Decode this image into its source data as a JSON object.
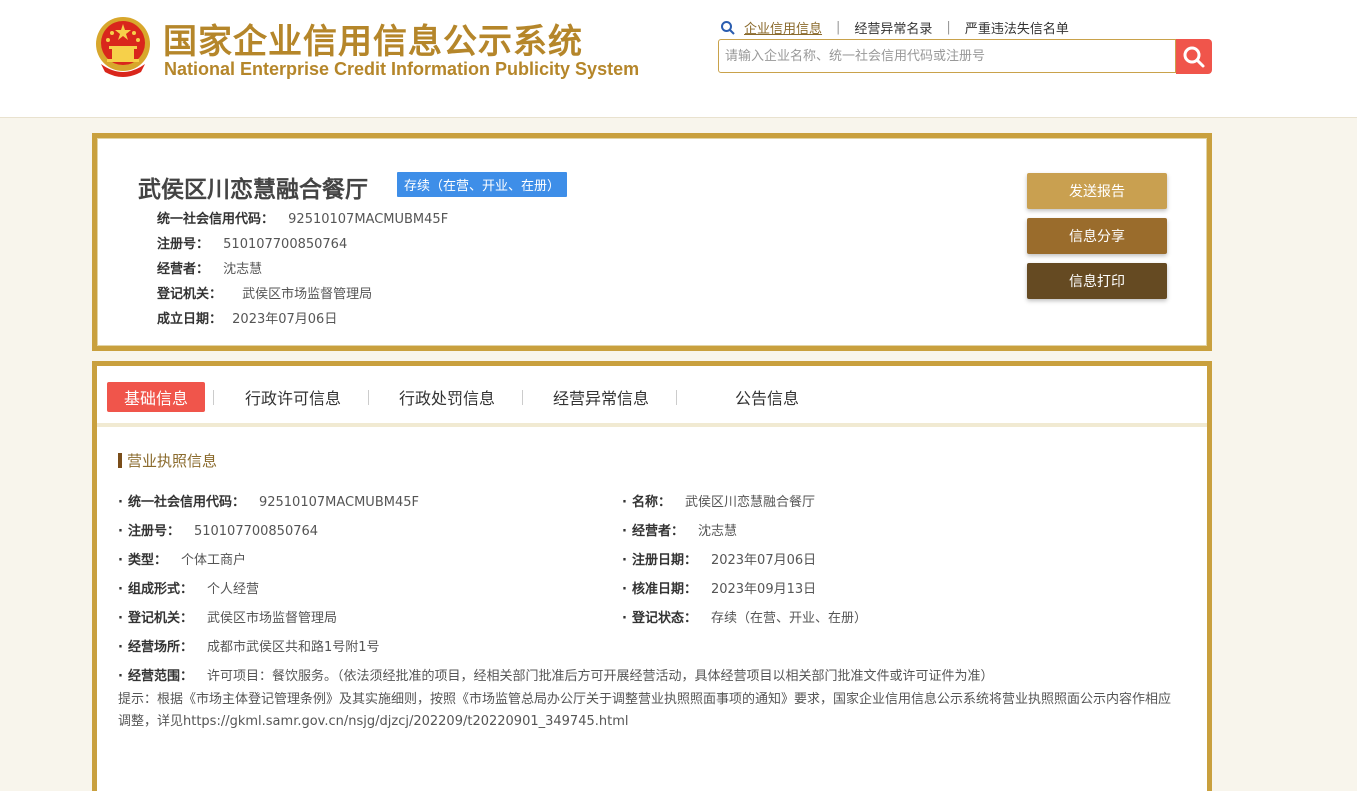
{
  "header": {
    "title_cn": "国家企业信用信息公示系统",
    "title_en": "National Enterprise Credit Information Publicity System",
    "links": [
      "企业信用信息",
      "经营异常名录",
      "严重违法失信名单"
    ],
    "search_placeholder": "请输入企业名称、统一社会信用代码或注册号"
  },
  "summary": {
    "company_name": "武侯区川恋慧融合餐厅",
    "status_badge": "存续（在营、开业、在册）",
    "rows": [
      {
        "k": "统一社会信用代码：",
        "v": "92510107MACMUBM45F"
      },
      {
        "k": "注册号：",
        "v": "510107700850764"
      },
      {
        "k": "经营者：",
        "v": "沈志慧"
      },
      {
        "k": "登记机关：",
        "v": "武侯区市场监督管理局"
      },
      {
        "k": "成立日期：",
        "v": "2023年07月06日"
      }
    ],
    "buttons": [
      "发送报告",
      "信息分享",
      "信息打印"
    ]
  },
  "tabs": [
    "基础信息",
    "行政许可信息",
    "行政处罚信息",
    "经营异常信息",
    "公告信息"
  ],
  "license": {
    "section_title": "营业执照信息",
    "left": [
      {
        "k": "统一社会信用代码：",
        "v": "92510107MACMUBM45F"
      },
      {
        "k": "注册号：",
        "v": "510107700850764"
      },
      {
        "k": "类型：",
        "v": "个体工商户"
      },
      {
        "k": "组成形式：",
        "v": "个人经营"
      },
      {
        "k": "登记机关：",
        "v": "武侯区市场监督管理局"
      },
      {
        "k": "经营场所：",
        "v": "成都市武侯区共和路1号附1号"
      },
      {
        "k": "经营范围：",
        "v": "许可项目：餐饮服务。（依法须经批准的项目，经相关部门批准后方可开展经营活动，具体经营项目以相关部门批准文件或许可证件为准）"
      }
    ],
    "right": [
      {
        "k": "名称：",
        "v": "武侯区川恋慧融合餐厅"
      },
      {
        "k": "经营者：",
        "v": "沈志慧"
      },
      {
        "k": "注册日期：",
        "v": "2023年07月06日"
      },
      {
        "k": "核准日期：",
        "v": "2023年09月13日"
      },
      {
        "k": "登记状态：",
        "v": "存续（在营、开业、在册）"
      }
    ],
    "note": "提示：根据《市场主体登记管理条例》及其实施细则，按照《市场监管总局办公厅关于调整营业执照照面事项的通知》要求，国家企业信用信息公示系统将营业执照照面公示内容作相应调整，详见https://gkml.samr.gov.cn/nsjg/djzcj/202209/t20220901_349745.html"
  },
  "colors": {
    "gold": "#c9a03e",
    "accent_red": "#f0554b",
    "badge_blue": "#3e8ee8",
    "btn_send": "#c9a050",
    "btn_share": "#9a6c2c",
    "btn_print": "#654a22"
  }
}
